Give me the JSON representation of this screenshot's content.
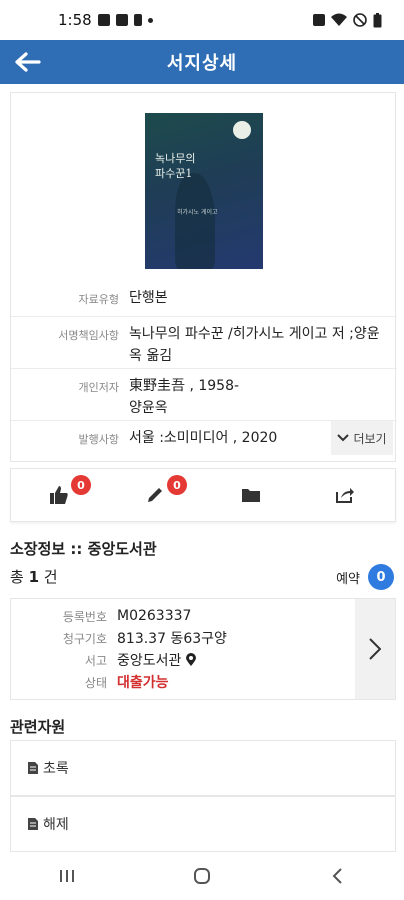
{
  "status_bar": {
    "time": "1:58"
  },
  "app_bar": {
    "title": "서지상세"
  },
  "book": {
    "cover": {
      "title_line1": "녹나무의",
      "title_line2": "파수꾼1",
      "subtitle": "히가시노 게이고"
    },
    "fields": [
      {
        "label": "자료유형",
        "value": "단행본"
      },
      {
        "label": "서명책임사항",
        "value": "녹나무의 파수꾼 /히가시노 게이고 저 ;양윤옥 옮김"
      },
      {
        "label": "개인저자",
        "value": "東野圭吾 , 1958-\n양윤옥"
      },
      {
        "label": "발행사항",
        "value": "서울 :소미미디어 , 2020"
      }
    ],
    "more_label": "더보기"
  },
  "actions": {
    "like_count": "0",
    "comment_count": "0"
  },
  "holdings": {
    "section_title": "소장정보 :: 중앙도서관",
    "total_prefix": "총 ",
    "total_count": "1",
    "total_suffix": " 건",
    "reserve_label": "예약",
    "reserve_count": "0",
    "rows": [
      {
        "label": "등록번호",
        "value": "M0263337"
      },
      {
        "label": "청구기호",
        "value": "813.37 동63구양"
      },
      {
        "label": "서고",
        "value": "중앙도서관"
      },
      {
        "label": "상태",
        "value": "대출가능"
      }
    ]
  },
  "related": {
    "section_title": "관련자원",
    "items": [
      {
        "label": "초록"
      },
      {
        "label": "해제"
      }
    ]
  },
  "colors": {
    "accent": "#2f6db5",
    "badge": "#e53935",
    "status_available": "#d32f2f",
    "reserve": "#2f7be0"
  }
}
